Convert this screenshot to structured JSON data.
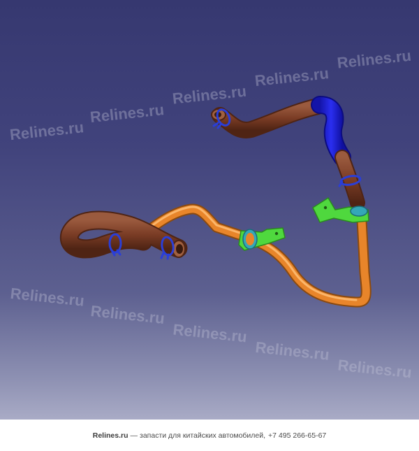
{
  "watermark": {
    "text": "Relines.ru",
    "color": "#c8c9dc"
  },
  "model": {
    "icon": "heater-hose-assembly-3d-render",
    "colors": {
      "brown_hose": "#7a3c25",
      "orange_pipe": "#e8852a",
      "blue_hose": "#1d1fd6",
      "green_bracket": "#4fd83e",
      "teal_grommet": "#34a7b8",
      "blue_clamp": "#2a3ed8"
    }
  },
  "footer": {
    "brand": "Relines.ru",
    "separator": "—",
    "tagline": "запасти для китайских автомобилей,",
    "phone": "+7 495 266-65-67"
  }
}
